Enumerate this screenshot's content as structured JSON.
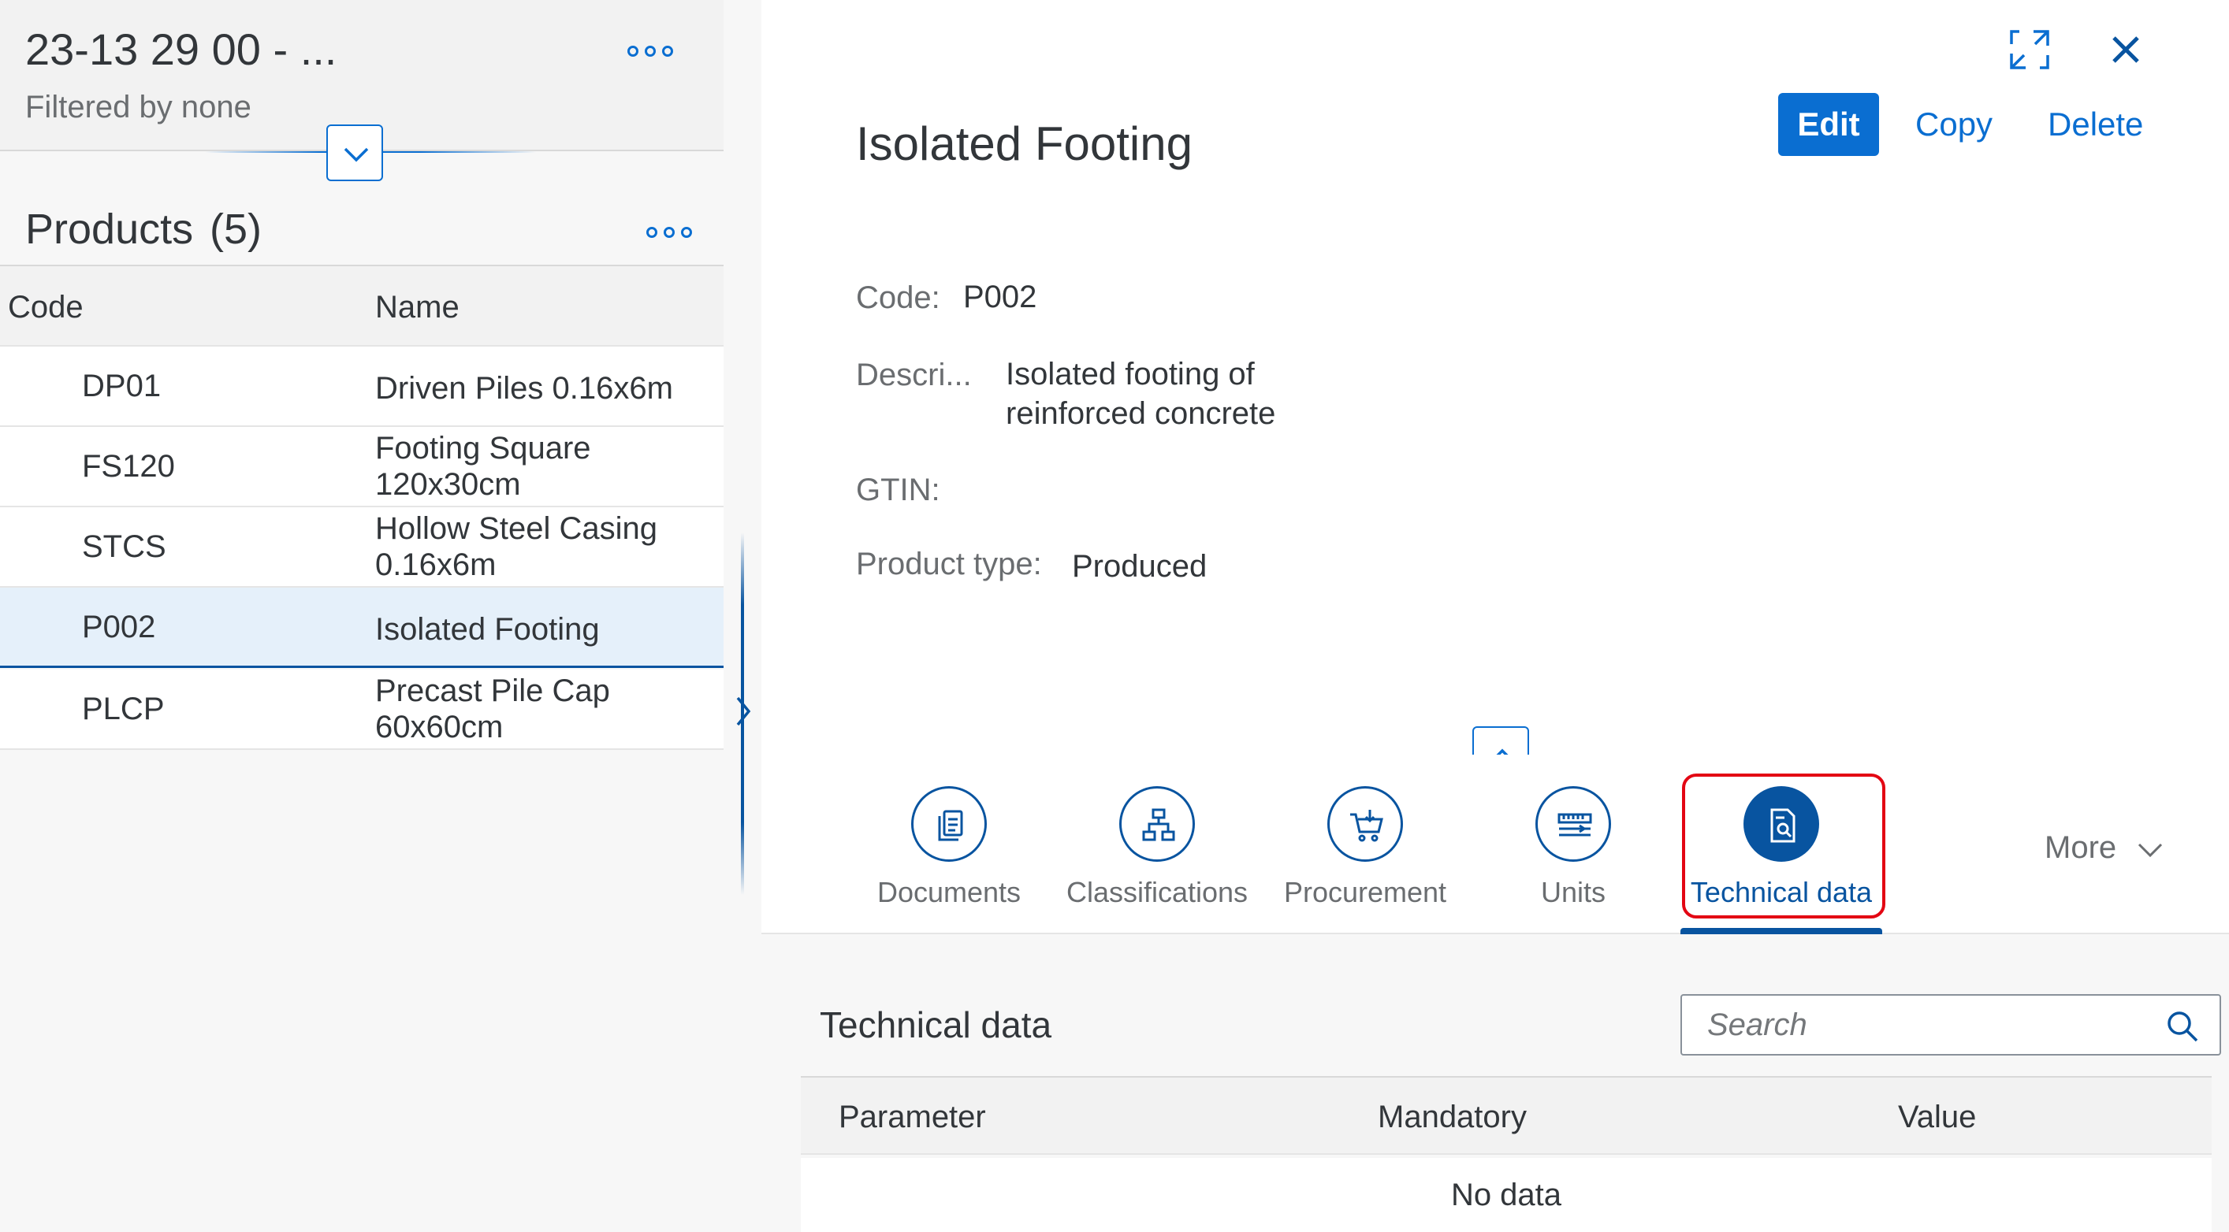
{
  "master": {
    "title": "23-13 29 00 - ...",
    "filter_text": "Filtered by none",
    "list_title": "Products",
    "list_count": "(5)",
    "columns": {
      "code": "Code",
      "name": "Name"
    },
    "rows": [
      {
        "code": "DP01",
        "name": "Driven Piles 0.16x6m"
      },
      {
        "code": "FS120",
        "name": "Footing Square 120x30cm"
      },
      {
        "code": "STCS",
        "name": "Hollow Steel Casing 0.16x6m"
      },
      {
        "code": "P002",
        "name": "Isolated Footing"
      },
      {
        "code": "PLCP",
        "name": "Precast Pile Cap 60x60cm"
      }
    ],
    "selected_row": "P002"
  },
  "detail": {
    "title": "Isolated Footing",
    "actions": {
      "edit": "Edit",
      "copy": "Copy",
      "delete": "Delete"
    },
    "attributes": {
      "code_label": "Code:",
      "code_value": "P002",
      "desc_label": "Descri...",
      "desc_value_line1": "Isolated footing of",
      "desc_value_line2": "reinforced concrete",
      "gtin_label": "GTIN:",
      "type_label": "Product type:",
      "type_value": "Produced"
    },
    "tabs": [
      {
        "label": "Documents",
        "icon": "documents-icon"
      },
      {
        "label": "Classifications",
        "icon": "hierarchy-icon"
      },
      {
        "label": "Procurement",
        "icon": "cart-icon"
      },
      {
        "label": "Units",
        "icon": "measure-icon"
      },
      {
        "label": "Technical data",
        "icon": "technical-document-icon"
      }
    ],
    "active_tab": "Technical data",
    "more_label": "More",
    "section": {
      "title": "Technical data",
      "search_placeholder": "Search",
      "columns": {
        "parameter": "Parameter",
        "mandatory": "Mandatory",
        "value": "Value"
      },
      "empty_text": "No data"
    }
  },
  "colors": {
    "accent": "#0a6ed1",
    "accent_dark": "#0854a0",
    "highlight": "#e30613",
    "selected_row": "#e5f0fa"
  }
}
